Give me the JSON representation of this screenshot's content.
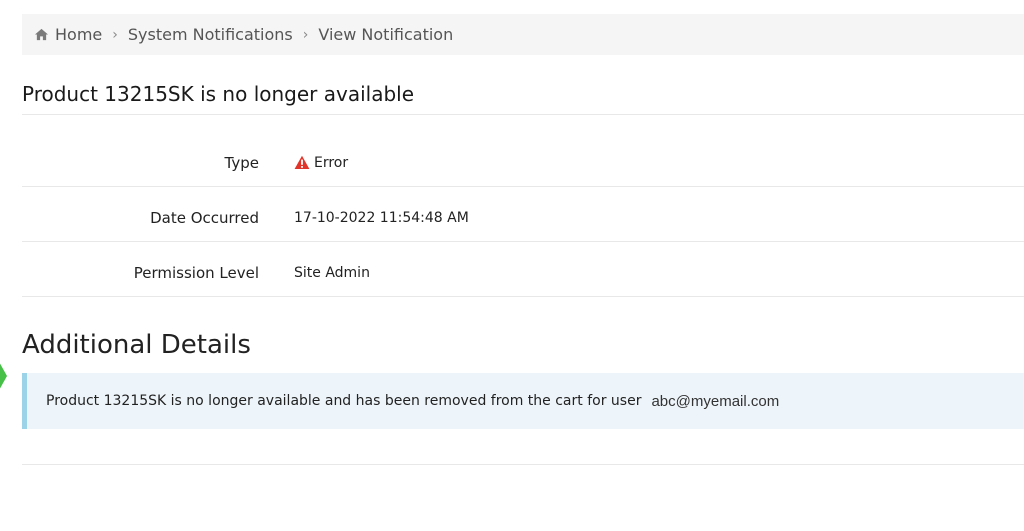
{
  "breadcrumb": {
    "items": [
      {
        "label": "Home",
        "icon": "home-icon"
      },
      {
        "label": "System Notifications"
      },
      {
        "label": "View Notification"
      }
    ]
  },
  "notification": {
    "title": "Product 13215SK is no longer available",
    "fields": [
      {
        "label": "Type",
        "value": "Error",
        "icon": "warning-icon",
        "icon_color": "#e0352b"
      },
      {
        "label": "Date Occurred",
        "value": "17-10-2022 11:54:48 AM"
      },
      {
        "label": "Permission Level",
        "value": "Site Admin"
      }
    ]
  },
  "additional": {
    "heading": "Additional Details",
    "message": "Product 13215SK is no longer available and has been removed from the cart for user",
    "email": "abc@myemail.com"
  },
  "colors": {
    "info_bg": "#eef5fa",
    "info_border": "#9dd3e8",
    "breadcrumb_bg": "#f5f5f5",
    "marker": "#46c046"
  }
}
